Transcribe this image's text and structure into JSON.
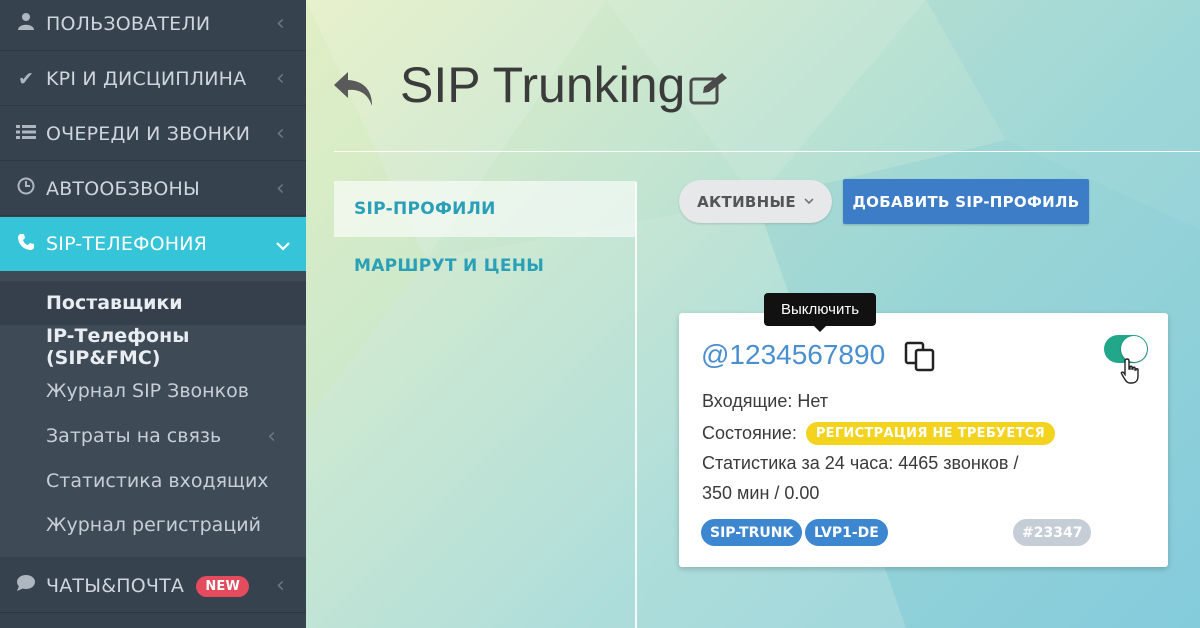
{
  "sidebar": {
    "items": [
      {
        "label": "ПОЛЬЗОВАТЕЛИ",
        "icon": "user-icon"
      },
      {
        "label": "KPI И ДИСЦИПЛИНА",
        "icon": "check-icon"
      },
      {
        "label": "ОЧЕРЕДИ И ЗВОНКИ",
        "icon": "list-icon"
      },
      {
        "label": "АВТООБЗВОНЫ",
        "icon": "clock-icon"
      },
      {
        "label": "SIP-ТЕЛЕФОНИЯ",
        "icon": "phone-icon",
        "active": true
      },
      {
        "label": "ЧАТЫ&ПОЧТА",
        "icon": "chat-icon",
        "badge": "NEW"
      }
    ],
    "sub_items": [
      {
        "label": "Поставщики",
        "bold": true,
        "selected": true
      },
      {
        "label": "IP-Телефоны (SIP&FMC)",
        "bold": true
      },
      {
        "label": "Журнал SIP Звонков"
      },
      {
        "label": "Затраты на связь",
        "has_children": true
      },
      {
        "label": "Статистика входящих"
      },
      {
        "label": "Журнал регистраций"
      }
    ],
    "active_color": "#36c4d8"
  },
  "header": {
    "title": "SIP Trunking"
  },
  "tabs": [
    {
      "label": "SIP-ПРОФИЛИ",
      "active": true
    },
    {
      "label": "МАРШРУТ И ЦЕНЫ"
    }
  ],
  "toolbar": {
    "filter_label": "АКТИВНЫЕ",
    "add_label": "ДОБАВИТЬ SIP-ПРОФИЛЬ"
  },
  "card": {
    "sip_id": "@1234567890",
    "incoming_label": "Входящие: Нет",
    "state_label": "Состояние:",
    "state_badge": "РЕГИСТРАЦИЯ НЕ ТРЕБУЕТСЯ",
    "stats_line1": "Статистика за 24 часа: 4465 звонков /",
    "stats_line2": "350 мин / 0.00",
    "tags": [
      "SIP-TRUNK",
      "LVP1-DE"
    ],
    "id_tag": "#23347",
    "toggle_on": true,
    "toggle_tooltip": "Выключить"
  },
  "colors": {
    "accent": "#36c4d8",
    "primary_button": "#3d7cc6",
    "toggle": "#22a78a",
    "badge_yellow": "#f4d31f",
    "badge_red": "#e44b5c"
  }
}
